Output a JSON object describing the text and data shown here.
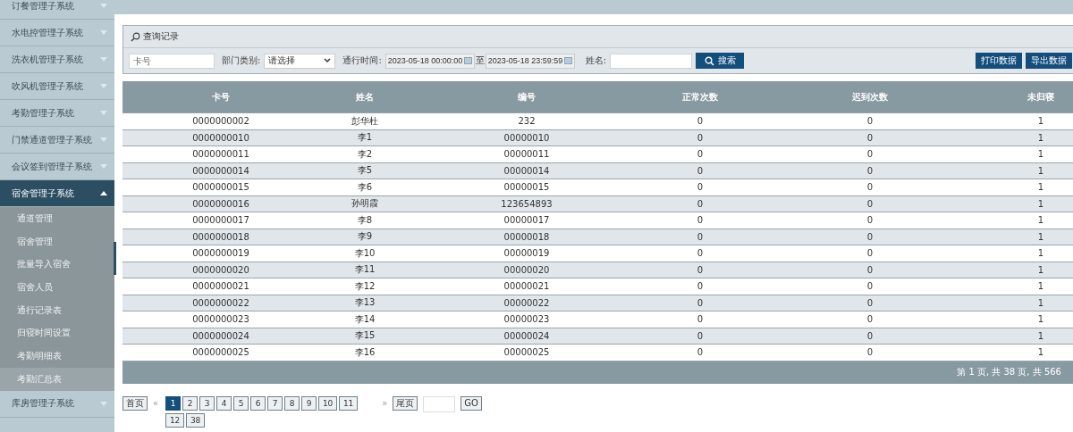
{
  "sidebar": {
    "items": [
      {
        "label": "订餐管理子系统",
        "expanded": false
      },
      {
        "label": "水电控管理子系统",
        "expanded": false
      },
      {
        "label": "洗衣机管理子系统",
        "expanded": false
      },
      {
        "label": "吹风机管理子系统",
        "expanded": false
      },
      {
        "label": "考勤管理子系统",
        "expanded": false
      },
      {
        "label": "门禁通道管理子系统",
        "expanded": false
      },
      {
        "label": "会议签到管理子系统",
        "expanded": false
      },
      {
        "label": "宿舍管理子系统",
        "expanded": true,
        "children": [
          {
            "label": "通道管理",
            "selected": false
          },
          {
            "label": "宿舍管理",
            "selected": false
          },
          {
            "label": "批量导入宿舍",
            "selected": false
          },
          {
            "label": "宿舍人员",
            "selected": false
          },
          {
            "label": "通行记录表",
            "selected": false
          },
          {
            "label": "归寝时间设置",
            "selected": false
          },
          {
            "label": "考勤明细表",
            "selected": false
          },
          {
            "label": "考勤汇总表",
            "selected": true
          }
        ]
      },
      {
        "label": "库房管理子系统",
        "expanded": false
      }
    ]
  },
  "query": {
    "title": "查询记录",
    "card_field": {
      "placeholder": "卡号"
    },
    "department_label": "部门类别:",
    "department_select": "请选择",
    "time_label": "通行时间:",
    "time_from": "2023-05-18 00:00:00",
    "time_separator": "至",
    "time_to": "2023-05-18 23:59:59",
    "name_label": "姓名:",
    "search_button": "搜索",
    "print_button": "打印数据",
    "export_button": "导出数据"
  },
  "table": {
    "columns": [
      "卡号",
      "姓名",
      "编号",
      "正常次数",
      "迟到次数",
      "未归寝"
    ],
    "rows": [
      [
        "0000000002",
        "彭华杜",
        "232",
        "0",
        "0",
        "1"
      ],
      [
        "0000000010",
        "李1",
        "00000010",
        "0",
        "0",
        "1"
      ],
      [
        "0000000011",
        "李2",
        "00000011",
        "0",
        "0",
        "1"
      ],
      [
        "0000000014",
        "李5",
        "00000014",
        "0",
        "0",
        "1"
      ],
      [
        "0000000015",
        "李6",
        "00000015",
        "0",
        "0",
        "1"
      ],
      [
        "0000000016",
        "孙明霞",
        "123654893",
        "0",
        "0",
        "1"
      ],
      [
        "0000000017",
        "李8",
        "00000017",
        "0",
        "0",
        "1"
      ],
      [
        "0000000018",
        "李9",
        "00000018",
        "0",
        "0",
        "1"
      ],
      [
        "0000000019",
        "李10",
        "00000019",
        "0",
        "0",
        "1"
      ],
      [
        "0000000020",
        "李11",
        "00000020",
        "0",
        "0",
        "1"
      ],
      [
        "0000000021",
        "李12",
        "00000021",
        "0",
        "0",
        "1"
      ],
      [
        "0000000022",
        "李13",
        "00000022",
        "0",
        "0",
        "1"
      ],
      [
        "0000000023",
        "李14",
        "00000023",
        "0",
        "0",
        "1"
      ],
      [
        "0000000024",
        "李15",
        "00000024",
        "0",
        "0",
        "1"
      ],
      [
        "0000000025",
        "李16",
        "00000025",
        "0",
        "0",
        "1"
      ]
    ],
    "footer": "第 1 页, 共 38 页, 共 566"
  },
  "pagination": {
    "first": "首页",
    "prev": "«",
    "pages": [
      {
        "label": "1",
        "selected": true
      },
      {
        "label": "2",
        "selected": false
      },
      {
        "label": "3",
        "selected": false
      },
      {
        "label": "4",
        "selected": false
      },
      {
        "label": "5",
        "selected": false
      },
      {
        "label": "6",
        "selected": false
      },
      {
        "label": "7",
        "selected": false
      },
      {
        "label": "8",
        "selected": false
      },
      {
        "label": "9",
        "selected": false
      },
      {
        "label": "10",
        "selected": false
      },
      {
        "label": "11",
        "selected": false
      },
      {
        "label": "12",
        "selected": false
      },
      {
        "label": "38",
        "selected": false
      }
    ],
    "next": "»",
    "last": "尾页",
    "go": "GO"
  }
}
